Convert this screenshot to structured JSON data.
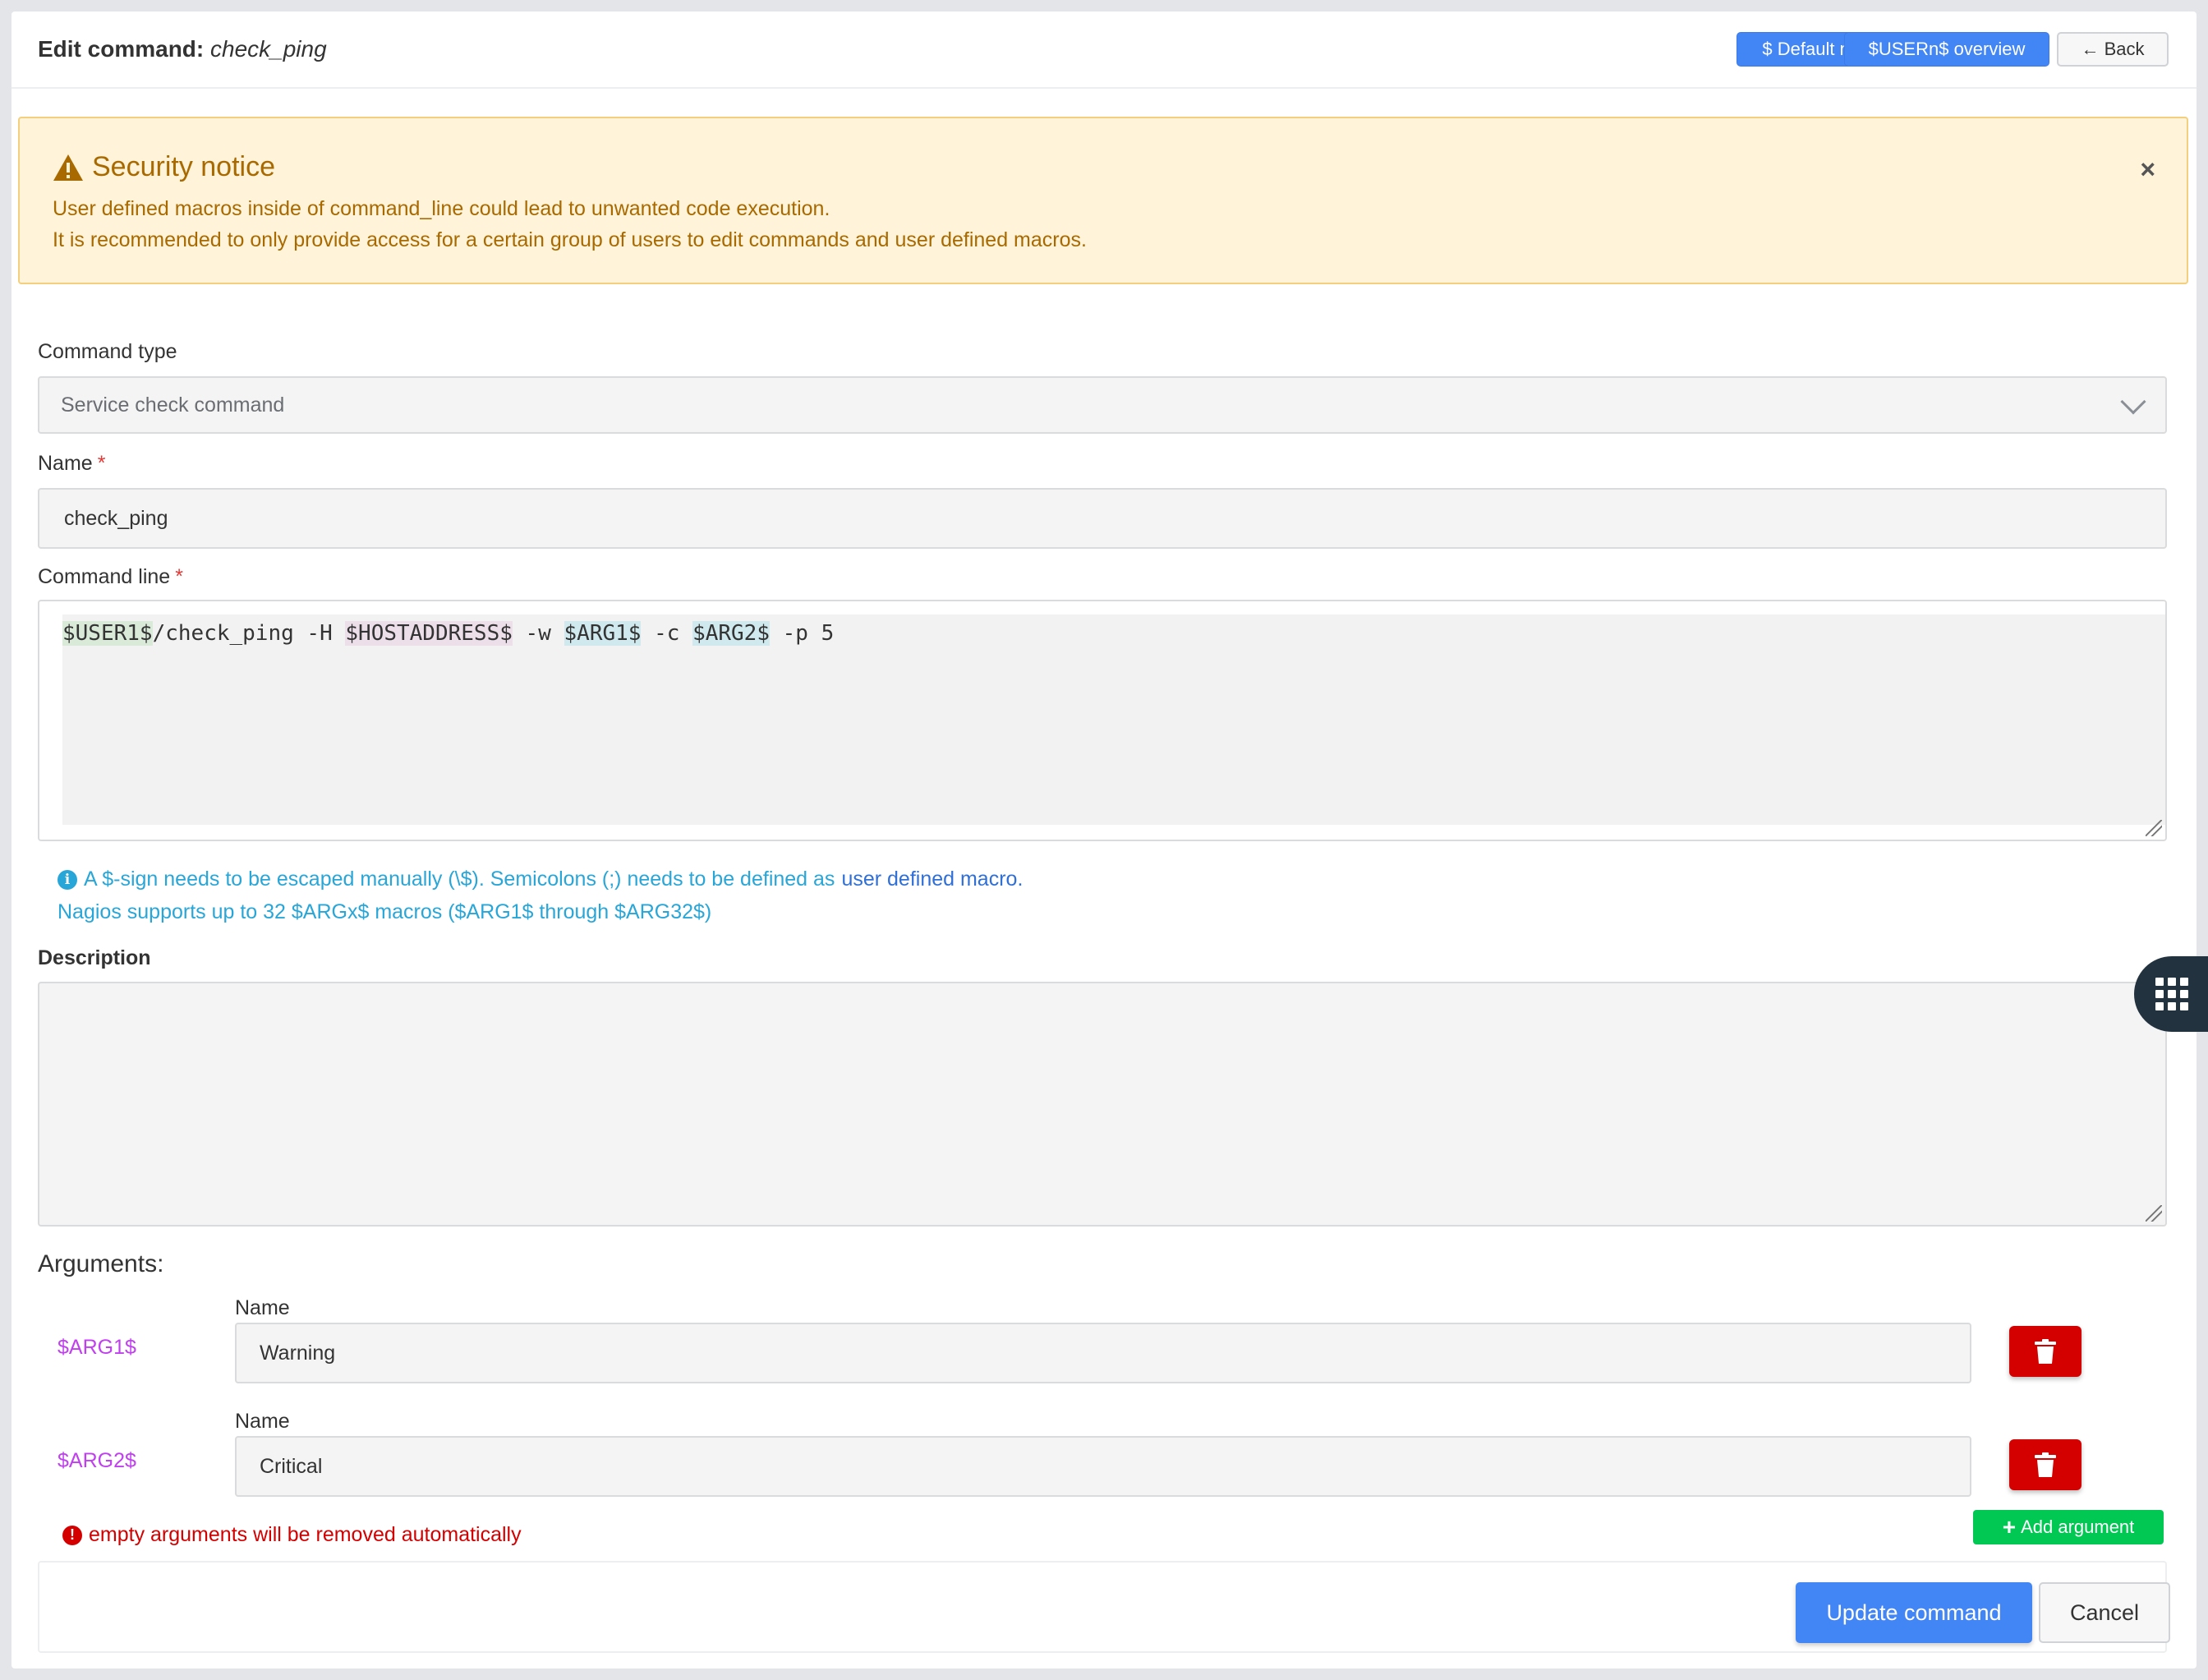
{
  "header": {
    "title_prefix": "Edit command:",
    "title_name": "check_ping",
    "buttons": {
      "default_macros": "$ Default macros overview",
      "usern_macros": "$USERn$ overview",
      "back": "← Back"
    }
  },
  "alert": {
    "title": "Security notice",
    "line1": "User defined macros inside of command_line could lead to unwanted code execution.",
    "line2": "It is recommended to only provide access for a certain group of users to edit commands and user defined macros.",
    "close": "×"
  },
  "form": {
    "command_type": {
      "label": "Command type",
      "value": "Service check command"
    },
    "name": {
      "label": "Name",
      "required_mark": "*",
      "value": "check_ping"
    },
    "command_line": {
      "label": "Command line",
      "required_mark": "*",
      "parts": {
        "user1": "$USER1$",
        "seg1": "/check_ping -H ",
        "hostaddress": "$HOSTADDRESS$",
        "seg2": " -w ",
        "arg1": "$ARG1$",
        "seg3": " -c ",
        "arg2": "$ARG2$",
        "seg4": " -p 5"
      }
    },
    "help": {
      "line1": "A $-sign needs to be escaped manually (\\$). Semicolons (;) needs to be defined as",
      "link": "user defined macro.",
      "line2": "Nagios supports up to 32 $ARGx$ macros ($ARG1$ through $ARG32$)"
    },
    "description": {
      "label": "Description",
      "value": ""
    }
  },
  "arguments": {
    "heading": "Arguments:",
    "items": [
      {
        "macro": "$ARG1$",
        "name_label": "Name",
        "value": "Warning"
      },
      {
        "macro": "$ARG2$",
        "name_label": "Name",
        "value": "Critical"
      }
    ],
    "note": "empty arguments will be removed automatically",
    "add_label": "Add argument"
  },
  "footer": {
    "update": "Update command",
    "cancel": "Cancel"
  },
  "colors": {
    "primary": "#4285f4",
    "warning_text": "#a86a00",
    "warning_bg": "#fff3d9",
    "danger": "#d40000",
    "success": "#00c853",
    "macro_purple": "#c040f0",
    "help_blue": "#29a6d8"
  },
  "icons": [
    "warning-triangle-icon",
    "close-icon",
    "chevron-down-icon",
    "info-icon",
    "trash-icon",
    "error-icon",
    "plus-icon",
    "grid-menu-icon"
  ]
}
